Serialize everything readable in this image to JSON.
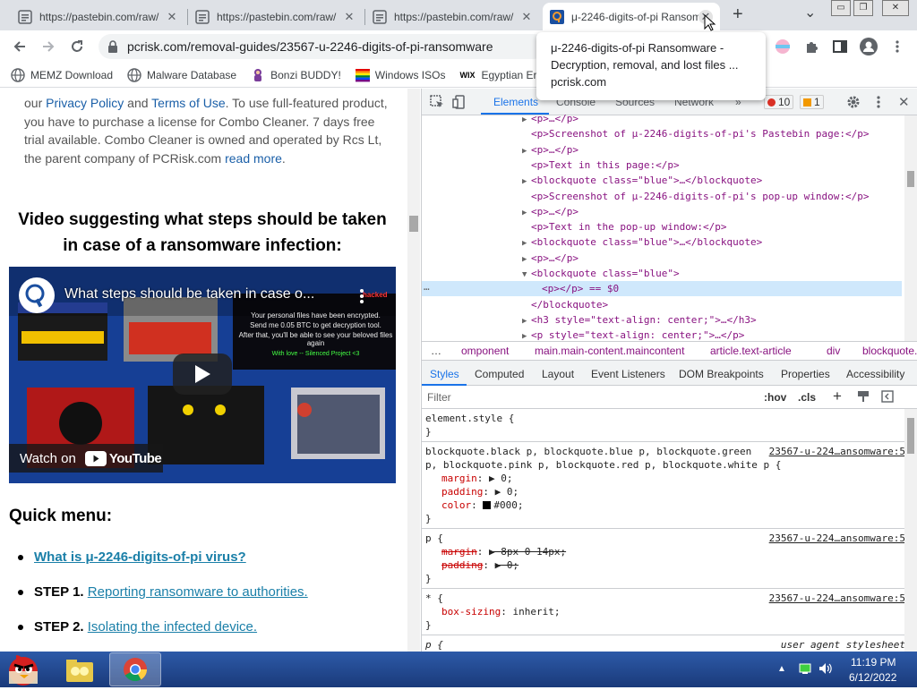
{
  "tabs": [
    {
      "title": "https://pastebin.com/raw/",
      "close": "✕"
    },
    {
      "title": "https://pastebin.com/raw/",
      "close": "✕"
    },
    {
      "title": "https://pastebin.com/raw/",
      "close": "✕"
    },
    {
      "title": "μ-2246-digits-of-pi Ransom",
      "close": "✕"
    }
  ],
  "new_tab": "+",
  "tab_search": "⌄",
  "window": {
    "minimize": "▭",
    "restore": "❐",
    "close": "✕"
  },
  "address": {
    "url": "pcrisk.com/removal-guides/23567-u-2246-digits-of-pi-ransomware"
  },
  "bookmarks": [
    {
      "label": "MEMZ Download",
      "color": "#2b79d8"
    },
    {
      "label": "Malware Database",
      "color": "#2b79d8"
    },
    {
      "label": "Bonzi BUDDY!",
      "color": "#7a3d9a"
    },
    {
      "label": "Windows ISOs",
      "color": "#f25022"
    },
    {
      "label": "Egyptian Er",
      "color": "#000000"
    }
  ],
  "tooltip": {
    "line1": "μ-2246-digits-of-pi Ransomware -",
    "line2": "Decryption, removal, and lost files ...",
    "domain": "pcrisk.com"
  },
  "page": {
    "para": {
      "pre": "our ",
      "link1": "Privacy Policy",
      "mid1": " and ",
      "link2": "Terms of Use",
      "post1": ". To use full-featured product, you have to purchase a license for Combo Cleaner. 7 days free trial available. Combo Cleaner is owned and operated by Rcs Lt, the parent company of PCRisk.com ",
      "link3": "read more",
      "post2": "."
    },
    "video_heading_1": "Video suggesting what steps should be taken",
    "video_heading_2": "in case of a ransomware infection:",
    "video": {
      "title": "What steps should be taken in case o...",
      "watch_on": "Watch on",
      "youtube": "YouTube",
      "scr1": "Your personal files have been encrypted.",
      "scr2": "Send me 0.05 BTC to get decryption tool.",
      "scr3": "After that, you'll be able to see your beloved files again",
      "scr4": "With love -- Silenced Project <3",
      "locked": "hacked"
    },
    "quick_menu": "Quick menu:",
    "items": [
      {
        "prefix": "",
        "link": "What is μ-2246-digits-of-pi virus?"
      },
      {
        "prefix": "STEP 1. ",
        "link": "Reporting ransomware to authorities."
      },
      {
        "prefix": "STEP 2. ",
        "link": "Isolating the infected device."
      }
    ]
  },
  "devtools": {
    "tabs": {
      "elements": "Elements",
      "console": "Console",
      "sources": "Sources",
      "network": "Network",
      "more": "»",
      "errors": "10",
      "warnings": "1"
    },
    "dom": [
      {
        "indent": 1,
        "arrow": "▶",
        "html": "<p>…</p>"
      },
      {
        "indent": 1,
        "arrow": "",
        "html": "<p>Screenshot of μ-2246-digits-of-pi's Pastebin page:</p>"
      },
      {
        "indent": 1,
        "arrow": "▶",
        "html": "<p>…</p>"
      },
      {
        "indent": 1,
        "arrow": "",
        "html": "<p>Text in this page:</p>"
      },
      {
        "indent": 1,
        "arrow": "▶",
        "html": "<blockquote class=\"blue\">…</blockquote>"
      },
      {
        "indent": 1,
        "arrow": "",
        "html": "<p>Screenshot of μ-2246-digits-of-pi's pop-up window:</p>"
      },
      {
        "indent": 1,
        "arrow": "▶",
        "html": "<p>…</p>"
      },
      {
        "indent": 1,
        "arrow": "",
        "html": "<p>Text in the pop-up window:</p>"
      },
      {
        "indent": 1,
        "arrow": "▶",
        "html": "<blockquote class=\"blue\">…</blockquote>"
      },
      {
        "indent": 1,
        "arrow": "▶",
        "html": "<p>…</p>"
      },
      {
        "indent": 1,
        "arrow": "▼",
        "html": "<blockquote class=\"blue\">"
      },
      {
        "indent": 2,
        "arrow": "",
        "html": "<p></p> == $0"
      },
      {
        "indent": 1,
        "arrow": "",
        "html": "</blockquote>"
      },
      {
        "indent": 1,
        "arrow": "▶",
        "html": "<h3 style=\"text-align: center;\">…</h3>"
      },
      {
        "indent": 1,
        "arrow": "▶",
        "html": "<p style=\"text-align: center;\">…</p>"
      }
    ],
    "ellipsis": "…",
    "crumbs": [
      "…",
      "omponent",
      "main.main-content.maincontent",
      "article.text-article",
      "div",
      "blockquote.blue",
      "p"
    ],
    "styles_tabs": [
      "Styles",
      "Computed",
      "Layout",
      "Event Listeners",
      "DOM Breakpoints",
      "Properties",
      "Accessibility"
    ],
    "filter_placeholder": "Filter",
    "hov": ":hov",
    "cls": ".cls",
    "plus": "+",
    "rules": [
      {
        "lines": [
          "element.style {",
          "}"
        ]
      },
      {
        "selector": "blockquote.black p, blockquote.blue p, blockquote.green",
        "selector2": "p, blockquote.pink p, blockquote.red p, blockquote.white p {",
        "source": "23567-u-224…ansomware:5",
        "props": [
          {
            "name": "margin",
            "value": "▶ 0;"
          },
          {
            "name": "padding",
            "value": "▶ 0;"
          },
          {
            "name": "color",
            "value": "#000;"
          }
        ]
      },
      {
        "selector": "p {",
        "source": "23567-u-224…ansomware:5",
        "props": [
          {
            "name": "margin",
            "value": "▶ 8px 0 14px;"
          },
          {
            "name": "padding",
            "value": "▶ 0;"
          }
        ]
      },
      {
        "selector": "* {",
        "source": "23567-u-224…ansomware:5",
        "props": [
          {
            "name": "box-sizing",
            "value": "inherit;"
          }
        ]
      },
      {
        "selector": "p {",
        "source": "user agent stylesheet",
        "props": [
          {
            "name": "display",
            "value": "block;"
          }
        ]
      }
    ]
  },
  "taskbar": {
    "time": "11:19 PM",
    "date": "6/12/2022"
  }
}
